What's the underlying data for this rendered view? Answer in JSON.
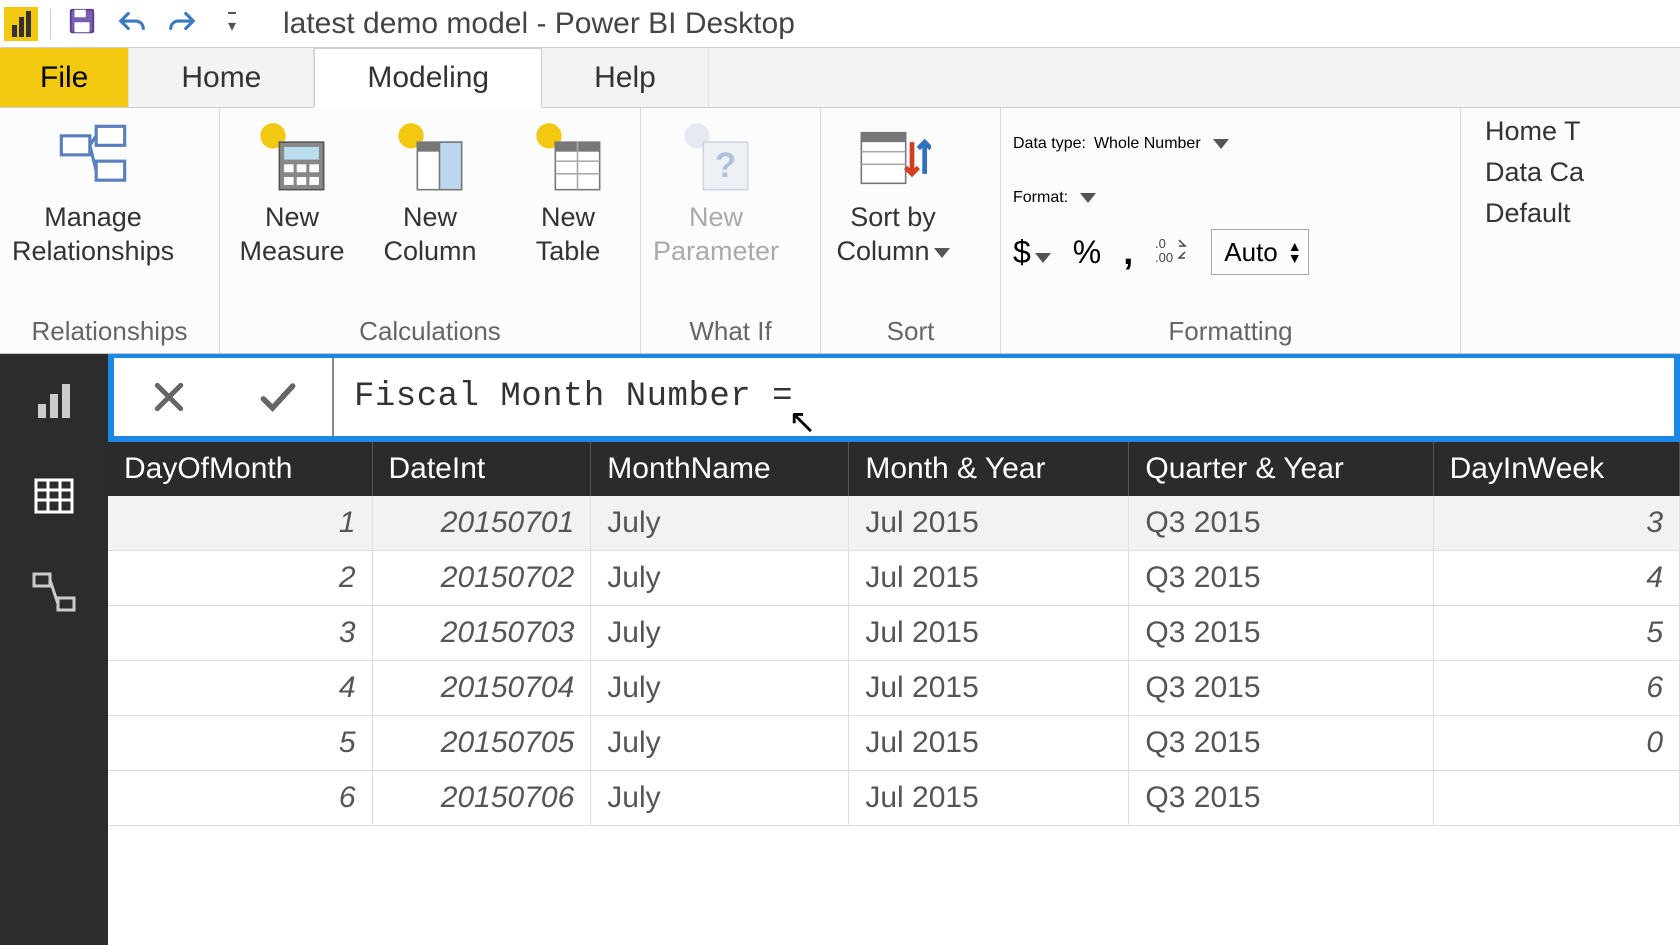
{
  "titlebar": {
    "title": "latest demo model - Power BI Desktop"
  },
  "tabs": {
    "file": "File",
    "home": "Home",
    "modeling": "Modeling",
    "help": "Help",
    "active": "modeling"
  },
  "ribbon": {
    "relationships": {
      "label": "Relationships",
      "manage": "Manage\nRelationships"
    },
    "calculations": {
      "label": "Calculations",
      "new_measure": "New\nMeasure",
      "new_column": "New\nColumn",
      "new_table": "New\nTable"
    },
    "whatif": {
      "label": "What If",
      "new_parameter": "New\nParameter"
    },
    "sort": {
      "label": "Sort",
      "sort_by_column": "Sort by\nColumn"
    },
    "formatting": {
      "label": "Formatting",
      "datatype_label": "Data type:",
      "datatype_value": "Whole Number",
      "format_label": "Format:",
      "currency": "$",
      "percent": "%",
      "comma": ",",
      "decimal_icon": ".00",
      "auto": "Auto"
    },
    "properties": {
      "home_table": "Home T",
      "data_category": "Data Ca",
      "default": "Default"
    }
  },
  "formula": {
    "text": "Fiscal Month Number ="
  },
  "columns": [
    "DayOfMonth",
    "DateInt",
    "MonthName",
    "Month & Year",
    "Quarter & Year",
    "DayInWeek"
  ],
  "rows": [
    {
      "DayOfMonth": "1",
      "DateInt": "20150701",
      "MonthName": "July",
      "MonthYear": "Jul 2015",
      "QuarterYear": "Q3 2015",
      "DayInWeek": "3"
    },
    {
      "DayOfMonth": "2",
      "DateInt": "20150702",
      "MonthName": "July",
      "MonthYear": "Jul 2015",
      "QuarterYear": "Q3 2015",
      "DayInWeek": "4"
    },
    {
      "DayOfMonth": "3",
      "DateInt": "20150703",
      "MonthName": "July",
      "MonthYear": "Jul 2015",
      "QuarterYear": "Q3 2015",
      "DayInWeek": "5"
    },
    {
      "DayOfMonth": "4",
      "DateInt": "20150704",
      "MonthName": "July",
      "MonthYear": "Jul 2015",
      "QuarterYear": "Q3 2015",
      "DayInWeek": "6"
    },
    {
      "DayOfMonth": "5",
      "DateInt": "20150705",
      "MonthName": "July",
      "MonthYear": "Jul 2015",
      "QuarterYear": "Q3 2015",
      "DayInWeek": "0"
    },
    {
      "DayOfMonth": "6",
      "DateInt": "20150706",
      "MonthName": "July",
      "MonthYear": "Jul 2015",
      "QuarterYear": "Q3 2015",
      "DayInWeek": ""
    }
  ]
}
